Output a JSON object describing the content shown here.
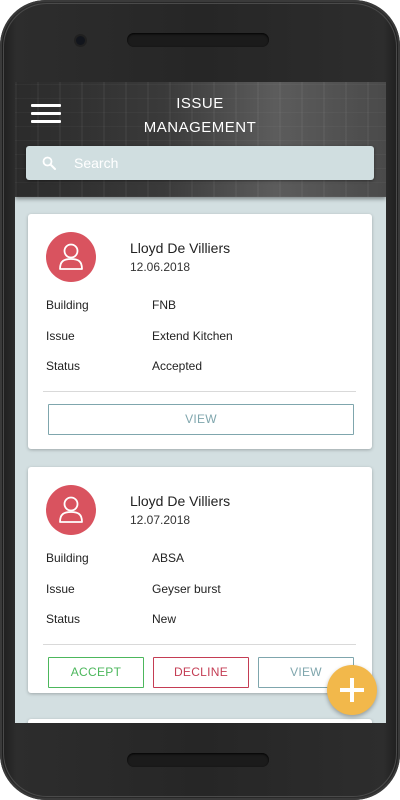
{
  "header": {
    "title_line1": "ISSUE",
    "title_line2": "MANAGEMENT"
  },
  "search": {
    "placeholder": "Search"
  },
  "issues": [
    {
      "name": "Lloyd De Villiers",
      "date": "12.06.2018",
      "building_label": "Building",
      "building": "FNB",
      "issue_label": "Issue",
      "issue": "Extend Kitchen",
      "status_label": "Status",
      "status": "Accepted",
      "view_label": "VIEW"
    },
    {
      "name": "Lloyd De Villiers",
      "date": "12.07.2018",
      "building_label": "Building",
      "building": "ABSA",
      "issue_label": "Issue",
      "issue": "Geyser burst",
      "status_label": "Status",
      "status": "New",
      "accept_label": "ACCEPT",
      "decline_label": "DECLINE",
      "view_label": "VIEW"
    }
  ],
  "colors": {
    "avatar": "#d9535f",
    "accept": "#4cb75c",
    "decline": "#c43d54",
    "view": "#7fa6ad",
    "fab": "#f2b84b"
  },
  "icons": {
    "menu": "hamburger-menu-icon",
    "search": "search-icon",
    "avatar": "user-icon",
    "fab": "plus-icon"
  }
}
